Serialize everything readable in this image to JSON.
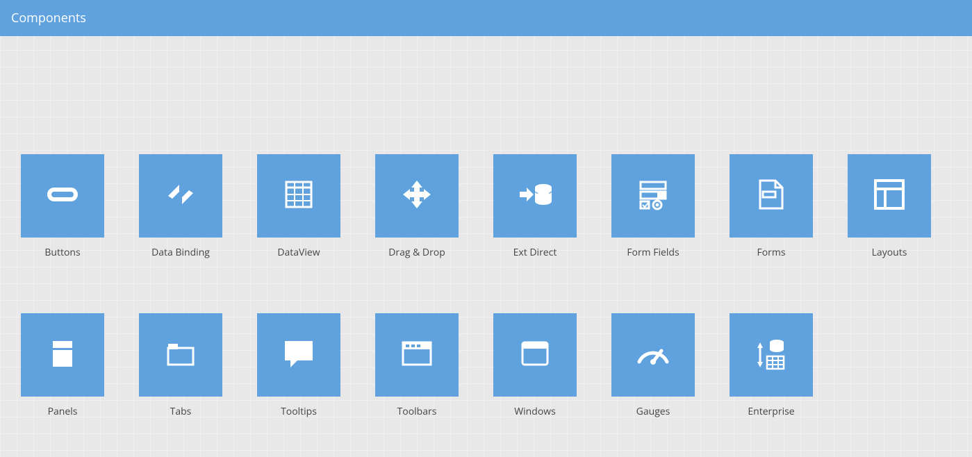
{
  "header": {
    "title": "Components"
  },
  "tiles": [
    {
      "label": "Buttons",
      "icon": "button-icon"
    },
    {
      "label": "Data Binding",
      "icon": "data-binding-icon"
    },
    {
      "label": "DataView",
      "icon": "dataview-icon"
    },
    {
      "label": "Drag & Drop",
      "icon": "drag-drop-icon"
    },
    {
      "label": "Ext Direct",
      "icon": "ext-direct-icon"
    },
    {
      "label": "Form Fields",
      "icon": "form-fields-icon"
    },
    {
      "label": "Forms",
      "icon": "forms-icon"
    },
    {
      "label": "Layouts",
      "icon": "layouts-icon"
    },
    {
      "label": "Panels",
      "icon": "panels-icon"
    },
    {
      "label": "Tabs",
      "icon": "tabs-icon"
    },
    {
      "label": "Tooltips",
      "icon": "tooltips-icon"
    },
    {
      "label": "Toolbars",
      "icon": "toolbars-icon"
    },
    {
      "label": "Windows",
      "icon": "windows-icon"
    },
    {
      "label": "Gauges",
      "icon": "gauges-icon"
    },
    {
      "label": "Enterprise",
      "icon": "enterprise-icon"
    }
  ],
  "colors": {
    "accent": "#5fa2dd",
    "icon": "#ffffff",
    "text": "#444444"
  }
}
